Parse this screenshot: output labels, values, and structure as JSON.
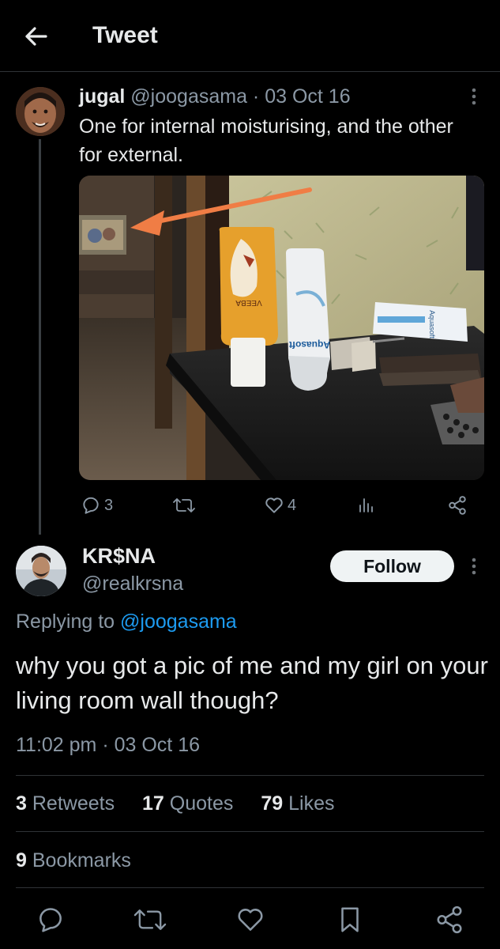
{
  "header": {
    "title": "Tweet"
  },
  "parent_tweet": {
    "name": "jugal",
    "handle": "@joogasama",
    "date_sep": " · ",
    "date": "03 Oct 16",
    "text": "One for internal moisturising, and the other for external.",
    "actions": {
      "replies": "3",
      "likes": "4"
    }
  },
  "reply_tweet": {
    "name": "KR$NA",
    "handle": "@realkrsna",
    "follow_label": "Follow",
    "replying_prefix": "Replying to ",
    "replying_handle": "@joogasama",
    "text": "why you got a pic of me and my girl on your living room wall though?",
    "time": "11:02 pm · 03 Oct 16",
    "stats": {
      "retweets_count": "3",
      "retweets_label": "Retweets",
      "quotes_count": "17",
      "quotes_label": "Quotes",
      "likes_count": "79",
      "likes_label": "Likes",
      "bookmarks_count": "9",
      "bookmarks_label": "Bookmarks"
    }
  },
  "photo_labels": {
    "bottle1_brand": "VEEBA",
    "bottle2_brand": "Aquasoft",
    "box_brand": "Aquasoft"
  },
  "colors": {
    "accent": "#1d9bf0",
    "background": "#000000",
    "arrow": "#f07d45",
    "muted": "#8b98a5"
  }
}
